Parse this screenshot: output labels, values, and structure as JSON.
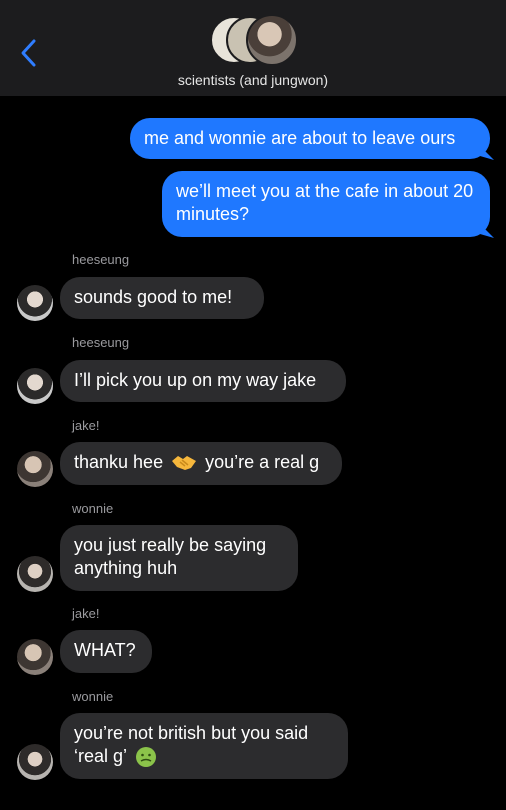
{
  "header": {
    "title": "scientists (and jungwon)",
    "back_icon": "chevron-left-icon",
    "accent": "#1f78ff"
  },
  "messages": [
    {
      "id": "m1",
      "direction": "outgoing",
      "text": "me and wonnie are about to leave ours"
    },
    {
      "id": "m2",
      "direction": "outgoing",
      "text": "we’ll meet you at the cafe in about 20 minutes?"
    },
    {
      "id": "m3",
      "direction": "incoming",
      "sender": "heeseung",
      "text": "sounds good to me!"
    },
    {
      "id": "m4",
      "direction": "incoming",
      "sender": "heeseung",
      "text": "I’ll pick you up on my way jake"
    },
    {
      "id": "m5",
      "direction": "incoming",
      "sender": "jake!",
      "text_before": "thanku hee",
      "emoji": "handshake",
      "text_after": "you’re a real g"
    },
    {
      "id": "m6",
      "direction": "incoming",
      "sender": "wonnie",
      "text": "you just really be saying anything huh"
    },
    {
      "id": "m7",
      "direction": "incoming",
      "sender": "jake!",
      "text": "WHAT?"
    },
    {
      "id": "m8",
      "direction": "incoming",
      "sender": "wonnie",
      "text_line1": "you’re not british but you said",
      "text_line2": "‘real g’",
      "emoji": "nauseated-face"
    }
  ]
}
